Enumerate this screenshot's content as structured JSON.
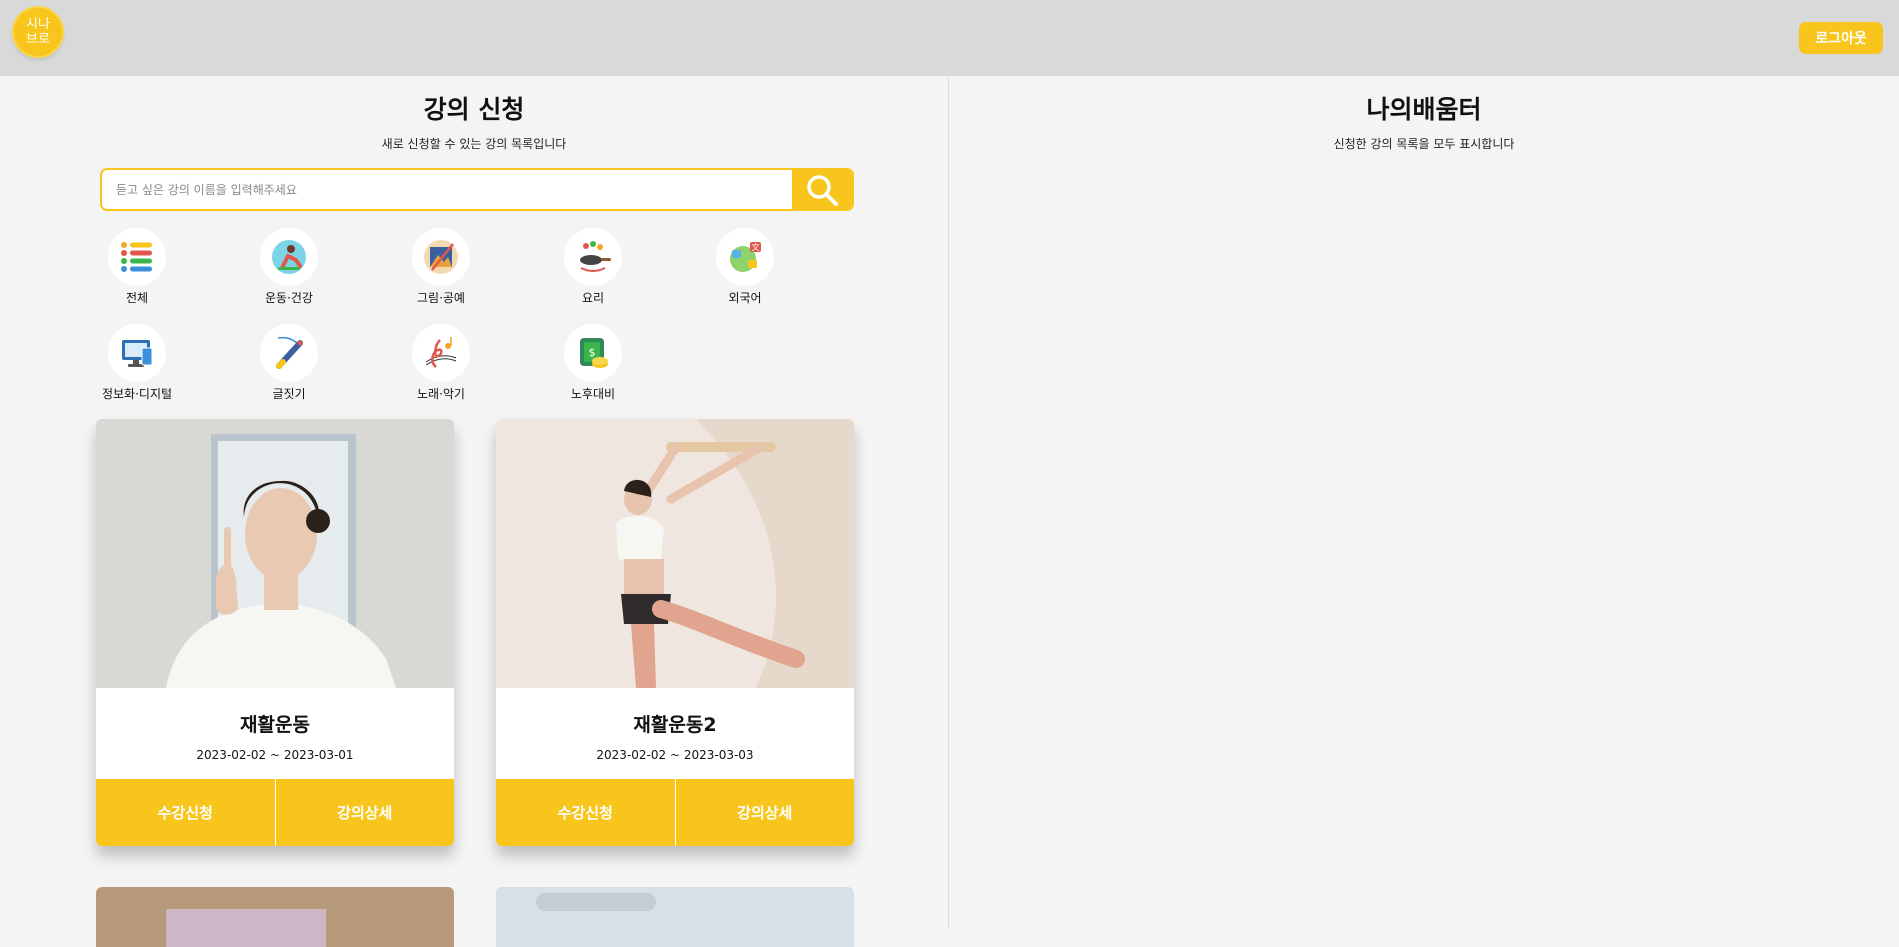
{
  "header": {
    "logo_line1": "시나",
    "logo_line2": "브로",
    "logout_label": "로그아웃"
  },
  "left_panel": {
    "title": "강의 신청",
    "subtitle": "새로 신청할 수 있는 강의 목록입니다",
    "search_placeholder": "듣고 싶은 강의 이름을 입력해주세요",
    "categories": [
      {
        "label": "전체",
        "icon": "list-icon"
      },
      {
        "label": "운동·건강",
        "icon": "exercise-icon"
      },
      {
        "label": "그림·공예",
        "icon": "art-icon"
      },
      {
        "label": "요리",
        "icon": "cooking-icon"
      },
      {
        "label": "외국어",
        "icon": "language-icon"
      },
      {
        "label": "정보화·디지털",
        "icon": "computer-icon"
      },
      {
        "label": "글짓기",
        "icon": "writing-icon"
      },
      {
        "label": "노래·악기",
        "icon": "music-icon"
      },
      {
        "label": "노후대비",
        "icon": "money-icon"
      }
    ],
    "courses": [
      {
        "title": "재활운동",
        "dates": "2023-02-02 ~ 2023-03-01",
        "enroll_label": "수강신청",
        "detail_label": "강의상세"
      },
      {
        "title": "재활운동2",
        "dates": "2023-02-02 ~ 2023-03-03",
        "enroll_label": "수강신청",
        "detail_label": "강의상세"
      }
    ]
  },
  "right_panel": {
    "title": "나의배움터",
    "subtitle": "신청한 강의 목록을 모두 표시합니다"
  },
  "colors": {
    "accent": "#f7c51b",
    "header_bg": "#d9d9d9",
    "page_bg": "#f4f4f4"
  }
}
